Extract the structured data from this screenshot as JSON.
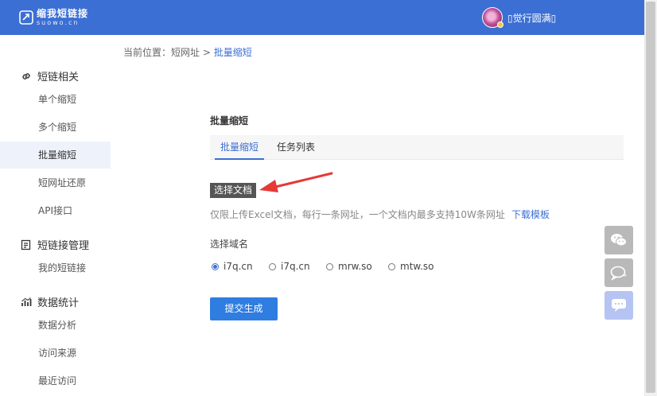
{
  "header": {
    "logo_cn": "缩我短链接",
    "logo_en": "suowo.cn",
    "username": "▯觉行圆满▯"
  },
  "sidebar": {
    "groups": [
      {
        "label": "短链相关",
        "icon": "link-icon",
        "items": [
          {
            "label": "单个缩短"
          },
          {
            "label": "多个缩短"
          },
          {
            "label": "批量缩短",
            "active": true
          },
          {
            "label": "短网址还原"
          },
          {
            "label": "API接口"
          }
        ]
      },
      {
        "label": "短链接管理",
        "icon": "edit-doc-icon",
        "items": [
          {
            "label": "我的短链接"
          }
        ]
      },
      {
        "label": "数据统计",
        "icon": "chart-icon",
        "items": [
          {
            "label": "数据分析"
          },
          {
            "label": "访问来源"
          },
          {
            "label": "最近访问"
          }
        ]
      }
    ]
  },
  "breadcrumb": {
    "prefix": "当前位置：",
    "parent": "短网址",
    "separator": " > ",
    "current": "批量缩短"
  },
  "main": {
    "title": "批量缩短",
    "tabs": [
      {
        "label": "批量缩短",
        "active": true
      },
      {
        "label": "任务列表"
      }
    ],
    "choose_file_label": "选择文档",
    "hint": "仅限上传Excel文档，每行一条网址，一个文档内最多支持10W条网址",
    "download_template": "下载模板",
    "domain_label": "选择域名",
    "domains": [
      {
        "label": "i7q.cn",
        "checked": true
      },
      {
        "label": "i7q.cn"
      },
      {
        "label": "mrw.so"
      },
      {
        "label": "mtw.so"
      }
    ],
    "submit_label": "提交生成"
  },
  "float_tools": [
    {
      "icon": "wechat-icon"
    },
    {
      "icon": "chat-bubble-icon"
    },
    {
      "icon": "message-icon"
    }
  ],
  "colors": {
    "header_bg": "#3c6fd4",
    "accent": "#3c6fd4",
    "submit_bg": "#2f7de1",
    "arrow": "#e53935"
  }
}
